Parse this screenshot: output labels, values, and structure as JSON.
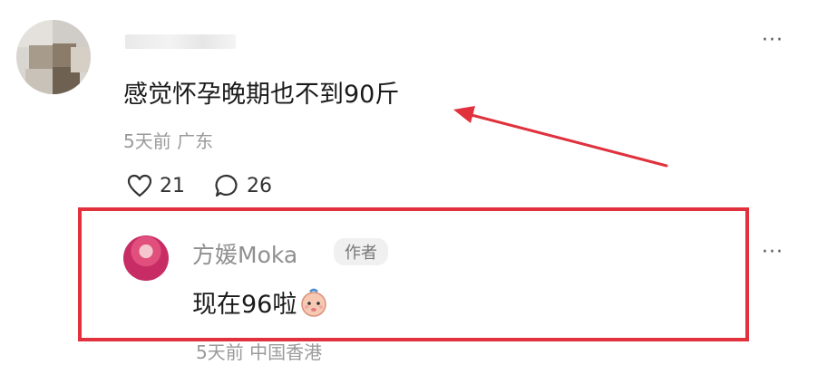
{
  "comment": {
    "text": "感觉怀孕晚期也不到90斤",
    "meta": "5天前 广东",
    "likes": "21",
    "replies": "26",
    "more_icon": "more-dots-icon"
  },
  "reply": {
    "author_name": "方媛Moka",
    "author_badge": "作者",
    "text": "现在96啦",
    "meta": "5天前 中国香港",
    "emoji_icon": "baby-face-emoji"
  },
  "colors": {
    "highlight": "#e0313c",
    "arrow": "#e0313c",
    "meta_gray": "#9a9a9a"
  }
}
